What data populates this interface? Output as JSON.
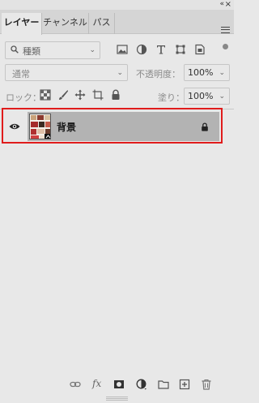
{
  "window": {
    "collapse_glyph": "«",
    "close_glyph": "×"
  },
  "tabs": [
    {
      "label": "レイヤー",
      "active": true
    },
    {
      "label": "チャンネル",
      "active": false
    },
    {
      "label": "パス",
      "active": false
    }
  ],
  "filter": {
    "kind_label": "種類",
    "icons": [
      "image-filter-icon",
      "adjustment-filter-icon",
      "type-filter-icon",
      "shape-filter-icon",
      "smart-object-filter-icon"
    ]
  },
  "blend": {
    "mode": "通常",
    "opacity_label": "不透明度：",
    "opacity_value": "100%"
  },
  "lock": {
    "label": "ロック：",
    "fill_label": "塗り：",
    "fill_value": "100%",
    "icons": [
      "lock-transparent-icon",
      "lock-image-icon",
      "lock-position-icon",
      "lock-artboard-icon",
      "lock-all-icon"
    ]
  },
  "layers": [
    {
      "name": "背景",
      "visible": true,
      "locked": true
    }
  ],
  "bottom_bar": {
    "icons": [
      "link-layers-icon",
      "fx-icon",
      "add-mask-icon",
      "adjustment-layer-icon",
      "group-folder-icon",
      "new-layer-icon",
      "delete-layer-icon"
    ],
    "fx_label": "fx"
  },
  "colors": {
    "panel_bg": "#e8e8e8",
    "tab_bar_bg": "#d5d5d5",
    "selected_layer_bg": "#b3b3b3",
    "highlight_border": "#e01c1c"
  }
}
